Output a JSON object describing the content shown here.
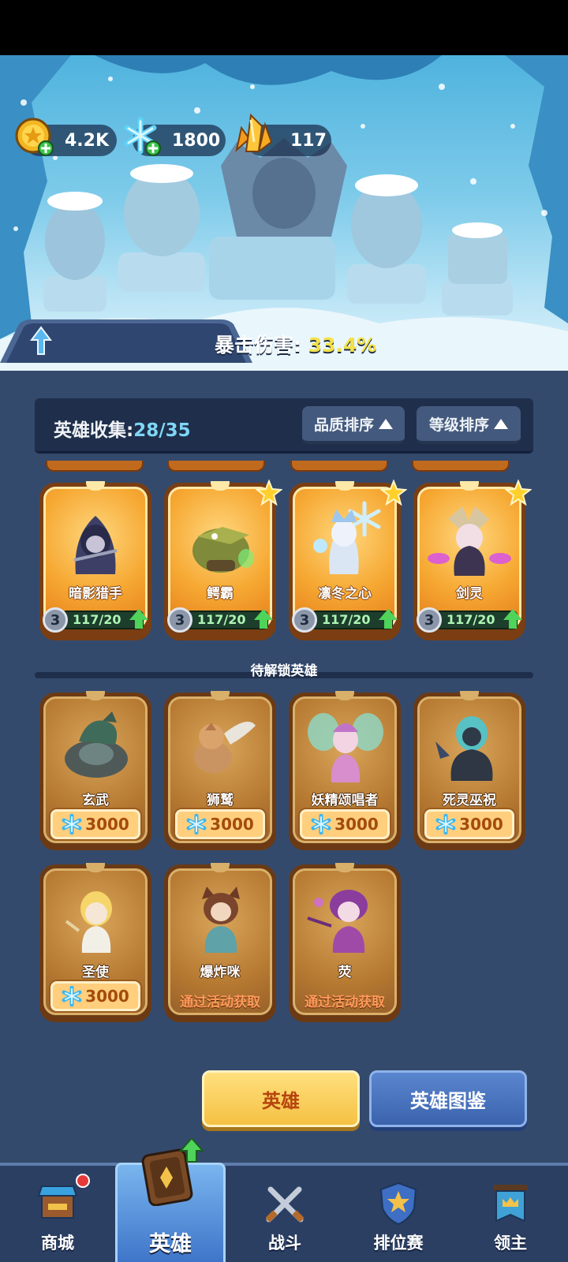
{
  "resources": {
    "gold": "4.2K",
    "diamond": "1800",
    "crystal": "117"
  },
  "buff": {
    "label": "暴击伤害:",
    "value": "33.4%"
  },
  "collection": {
    "label": "英雄收集:",
    "count": "28/35",
    "sort_quality": "品质排序",
    "sort_level": "等级排序"
  },
  "owned_heroes": [
    {
      "name": "暗影猎手",
      "level": "3",
      "progress": "117/20",
      "starred": false
    },
    {
      "name": "鳄霸",
      "level": "3",
      "progress": "117/20",
      "starred": true
    },
    {
      "name": "凛冬之心",
      "level": "3",
      "progress": "117/20",
      "starred": true
    },
    {
      "name": "剑灵",
      "level": "3",
      "progress": "117/20",
      "starred": true
    }
  ],
  "locked_section_title": "待解锁英雄",
  "locked_heroes": [
    {
      "name": "玄武",
      "cost": "3000"
    },
    {
      "name": "狮鹫",
      "cost": "3000"
    },
    {
      "name": "妖精颂唱者",
      "cost": "3000"
    },
    {
      "name": "死灵巫祝",
      "cost": "3000"
    },
    {
      "name": "圣使",
      "cost": "3000"
    },
    {
      "name": "爆炸咪",
      "event": "通过活动获取"
    },
    {
      "name": "荧",
      "event": "通过活动获取"
    }
  ],
  "buttons": {
    "heroes": "英雄",
    "atlas": "英雄图鉴"
  },
  "nav": {
    "shop": "商城",
    "heroes": "英雄",
    "battle": "战斗",
    "ranked": "排位赛",
    "lord": "领主"
  },
  "colors": {
    "panel": "#344a6c",
    "card_orange": "#f6a832",
    "progress_green": "#4fd35a",
    "crit_value": "#f3e24a"
  }
}
